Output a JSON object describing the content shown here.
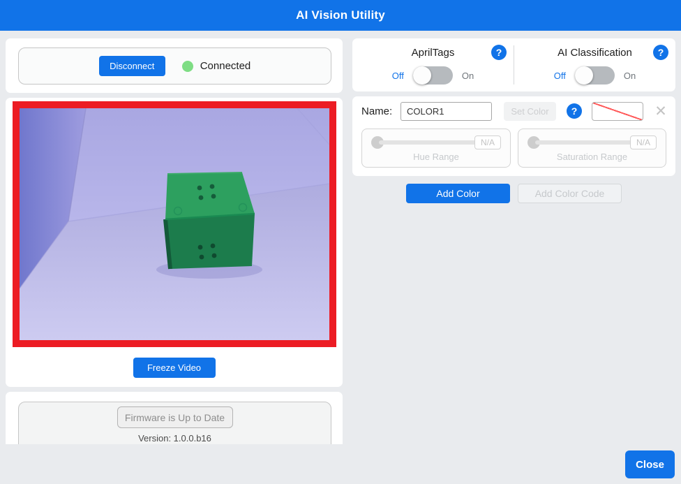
{
  "title_bar": {
    "title": "AI Vision Utility"
  },
  "connection": {
    "disconnect": "Disconnect",
    "status": "Connected"
  },
  "video": {
    "freeze": "Freeze Video"
  },
  "firmware": {
    "status_button": "Firmware is Up to Date",
    "version": "Version: 1.0.0.b16"
  },
  "detection": {
    "help": "?",
    "apriltags": {
      "label": "AprilTags",
      "off": "Off",
      "on": "On",
      "state": "off"
    },
    "classification": {
      "label": "AI Classification",
      "off": "Off",
      "on": "On",
      "state": "off"
    }
  },
  "color_editor": {
    "name_label": "Name:",
    "name_value": "COLOR1",
    "set_color": "Set Color",
    "help": "?",
    "clear": "✕",
    "hue": {
      "value": "N/A",
      "label": "Hue Range"
    },
    "saturation": {
      "value": "N/A",
      "label": "Saturation Range"
    },
    "add_color": "Add Color",
    "add_color_code": "Add Color Code"
  },
  "footer": {
    "close": "Close"
  },
  "colors": {
    "accent": "#1173e8",
    "page_bg": "#e9ebee",
    "video_border": "#ec1c24",
    "connected_green": "#7edd84",
    "cube_top": "#2da05f",
    "cube_front": "#1c7c4c",
    "scene_wall": "#b3b1e7"
  }
}
